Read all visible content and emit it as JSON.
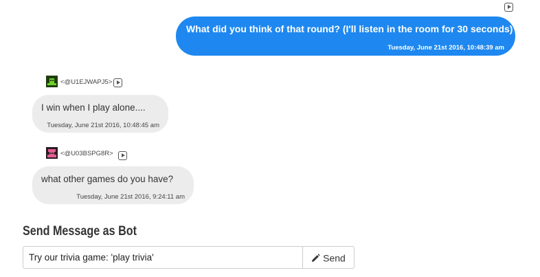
{
  "messages": {
    "outgoing": {
      "text": "What did you think of that round? (I'll listen in the room for 30 seconds)",
      "timestamp": "Tuesday, June 21st 2016, 10:48:39 am"
    },
    "incoming": [
      {
        "username": "<@U1EJWAPJ5>",
        "avatar_color": "#4caf1a",
        "text": "I win when I play alone....",
        "timestamp": "Tuesday, June 21st 2016, 10:48:45 am"
      },
      {
        "username": "<@U03BSPG8R>",
        "avatar_color": "#e05a8a",
        "text": "what other games do you have?",
        "timestamp": "Tuesday, June 21st 2016, 9:24:11 am"
      }
    ]
  },
  "send_form": {
    "title": "Send Message as Bot",
    "input_value": "Try our trivia game: 'play trivia'",
    "send_label": "Send"
  },
  "colors": {
    "outgoing_bubble": "#1e88f0",
    "incoming_bubble": "#ececec"
  }
}
